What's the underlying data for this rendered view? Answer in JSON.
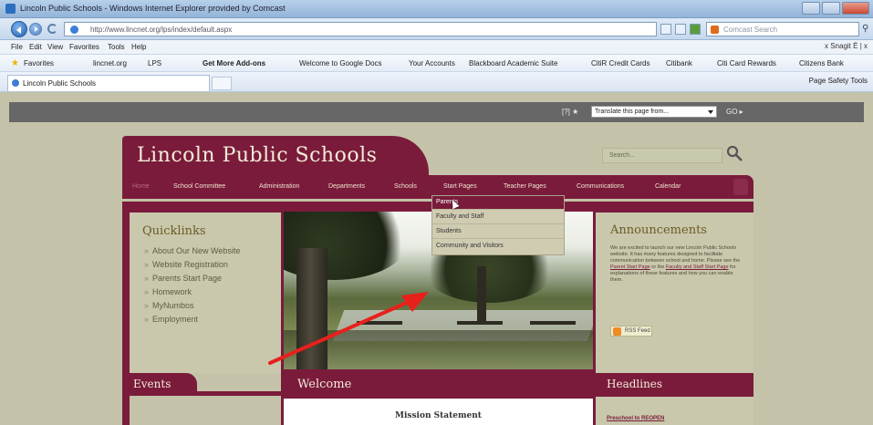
{
  "browser": {
    "window_title": "Lincoln Public Schools - Windows Internet Explorer provided by Comcast",
    "address": "http://www.lincnet.org/lps/index/default.aspx",
    "search_placeholder": "Comcast Search",
    "menu": [
      "File",
      "Edit",
      "View",
      "Favorites",
      "Tools",
      "Help"
    ],
    "menu_right": "x  Snagit  Ë  |  x  ",
    "favorites_label": "Favorites",
    "favorites": [
      {
        "label": "lincnet.org"
      },
      {
        "label": "LPS"
      },
      {
        "label": "Get More Add-ons",
        "bold": true
      },
      {
        "label": "Welcome to Google Docs"
      },
      {
        "label": "Your Accounts"
      },
      {
        "label": "Blackboard Academic Suite"
      },
      {
        "label": "CitiR Credit Cards"
      },
      {
        "label": "Citibank"
      },
      {
        "label": "Citi Card Rewards"
      },
      {
        "label": "Citizens Bank"
      }
    ],
    "tab_label": "Lincoln Public Schools",
    "command_bar": "Page  Safety  Tools"
  },
  "site": {
    "translate_label": "[?] ★",
    "translate_select": "Translate this page from...",
    "translate_go": "GO ▸",
    "title": "Lincoln Public Schools",
    "search_placeholder": "Search...",
    "nav": [
      {
        "label": "Home"
      },
      {
        "label": "School Committee"
      },
      {
        "label": "Administration"
      },
      {
        "label": "Departments"
      },
      {
        "label": "Schools"
      },
      {
        "label": "Start Pages"
      },
      {
        "label": "Teacher Pages"
      },
      {
        "label": "Communications"
      },
      {
        "label": "Calendar"
      }
    ],
    "dropdown": [
      {
        "label": "Parents",
        "active": true
      },
      {
        "label": "Faculty and Staff"
      },
      {
        "label": "Students"
      },
      {
        "label": "Community and Visitors"
      }
    ],
    "quicklinks": {
      "title": "Quicklinks",
      "items": [
        "About Our New Website",
        "Website Registration",
        "Parents Start Page",
        "Homework",
        "MyNumbos",
        "Employment"
      ]
    },
    "events_title": "Events",
    "welcome_title": "Welcome",
    "mission_title": "Mission Statement",
    "announcements": {
      "title": "Announcements",
      "text_1": "We are excited to launch our new Lincoln Public Schools website. It has many features designed to facilitate communication between school and home. Please see the ",
      "link_1": "Parent Start Page",
      "text_2": " or the ",
      "link_2": "Faculty and Staff Start Page",
      "text_3": " for explanations of these features and how you can enable them.",
      "rss_label": "RSS Feed"
    },
    "headlines_title": "Headlines",
    "headline_1": "Preschool to REOPEN"
  },
  "colors": {
    "brand": "#7a1b3b",
    "panel": "#c9c8ac",
    "page_bg": "#c4c3a9",
    "annotation_arrow": "#e8201c"
  }
}
